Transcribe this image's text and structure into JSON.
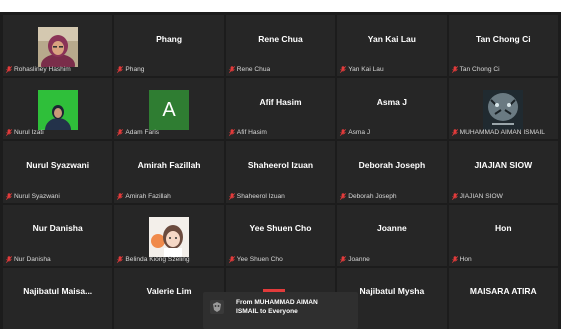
{
  "participants": [
    {
      "name": "Rohasliney Hashim",
      "label": "Rohasliney Hashim",
      "video": "photo-woman-hijab"
    },
    {
      "name": "Phang",
      "label": "Phang"
    },
    {
      "name": "Rene Chua",
      "label": "Rene Chua"
    },
    {
      "name": "Yan Kai Lau",
      "label": "Yan Kai Lau"
    },
    {
      "name": "Tan Chong Ci",
      "label": "Tan Chong Ci"
    },
    {
      "name": "Nurul Izati",
      "label": "Nurul Izati",
      "video": "green-screen-person"
    },
    {
      "name": "Adam Faris",
      "label": "Adam Faris",
      "avatar_letter": "A",
      "avatar_color": "#2f7d32"
    },
    {
      "name": "Afif Hasim",
      "label": "Afif Hasim"
    },
    {
      "name": "Asma J",
      "label": "Asma J"
    },
    {
      "name": "MUHAMMAD AIMAN ISMAIL",
      "label": "MUHAMMAD AIMAN ISMAIL",
      "video": "tiger-poster"
    },
    {
      "name": "Nurul Syazwani",
      "label": "Nurul Syazwani"
    },
    {
      "name": "Amirah Fazillah",
      "label": "Amirah Fazillah"
    },
    {
      "name": "Shaheerol Izuan",
      "label": "Shaheerol Izuan"
    },
    {
      "name": "Deborah Joseph",
      "label": "Deborah Joseph"
    },
    {
      "name": "JIAJIAN SIOW",
      "label": "JIAJIAN SIOW"
    },
    {
      "name": "Nur Danisha",
      "label": "Nur Danisha"
    },
    {
      "name": "Belinda Kiong Szeling",
      "label": "Belinda Kiong Szeling",
      "video": "anime-illustration"
    },
    {
      "name": "Yee Shuen Cho",
      "label": "Yee Shuen Cho"
    },
    {
      "name": "Joanne",
      "label": "Joanne"
    },
    {
      "name": "Hon",
      "label": "Hon"
    },
    {
      "name": "Najibatul  Maisa...",
      "label": ""
    },
    {
      "name": "Valerie Lim",
      "label": ""
    },
    {
      "name": "",
      "label": ""
    },
    {
      "name": "Najibatul Mysha",
      "label": ""
    },
    {
      "name": "MAISARA ATIRA",
      "label": ""
    }
  ],
  "chat_notification": {
    "line1": "From MUHAMMAD AIMAN",
    "line2": "ISMAIL to Everyone"
  },
  "colors": {
    "background": "#1c1c1c",
    "tile": "#262626",
    "mic_muted": "#e23b3b"
  },
  "icons": {
    "muted": "mic-muted-icon",
    "chat": "chat-avatar-icon"
  }
}
